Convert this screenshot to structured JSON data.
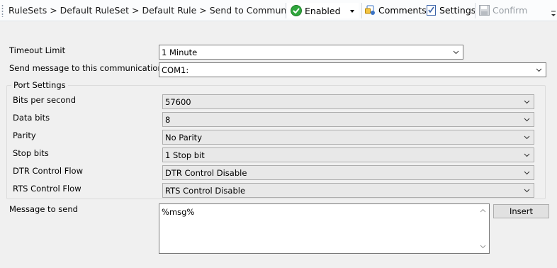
{
  "toolbar": {
    "breadcrumb": "RuleSets > Default RuleSet > Default Rule > Send to Communication Port",
    "status": {
      "label": "Enabled",
      "color": "#2fa63c"
    },
    "comments_label": "Comments",
    "settings_label": "Settings",
    "confirm_label": "Confirm"
  },
  "form": {
    "timeout": {
      "label": "Timeout Limit",
      "value": "1 Minute"
    },
    "port": {
      "label": "Send message to this communication port",
      "value": "COM1:"
    },
    "port_settings": {
      "title": "Port Settings",
      "rows": [
        {
          "label": "Bits per second",
          "value": "57600"
        },
        {
          "label": "Data bits",
          "value": "8"
        },
        {
          "label": "Parity",
          "value": "No Parity"
        },
        {
          "label": "Stop bits",
          "value": "1 Stop bit"
        },
        {
          "label": "DTR Control Flow",
          "value": "DTR Control Disable"
        },
        {
          "label": "RTS Control Flow",
          "value": "RTS Control Disable"
        }
      ]
    },
    "message": {
      "label": "Message to send",
      "value": "%msg%",
      "insert_label": "Insert"
    }
  },
  "icons": {
    "enabled": "check-circle-icon",
    "comments": "comments-icon",
    "settings": "settings-checklist-icon",
    "confirm": "save-disk-icon"
  }
}
